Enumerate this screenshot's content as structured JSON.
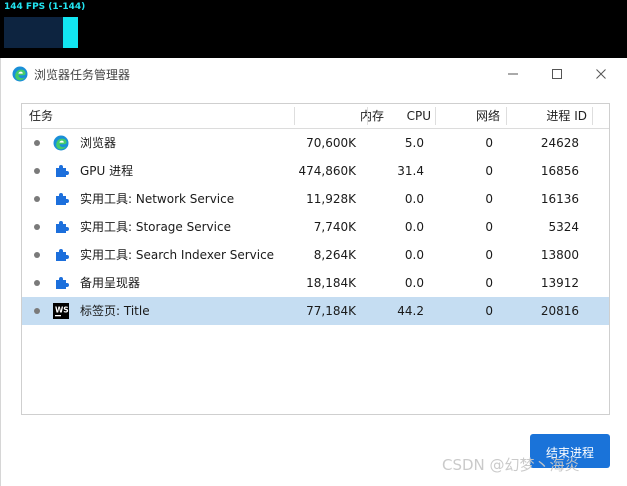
{
  "overlay": {
    "fps_text": "144 FPS (1-144)"
  },
  "window": {
    "title": "浏览器任务管理器"
  },
  "table": {
    "columns": [
      "任务",
      "内存",
      "CPU",
      "网络",
      "进程 ID"
    ],
    "rows": [
      {
        "icon": "edge-icon",
        "name": "浏览器",
        "memory": "70,600K",
        "cpu": "5.0",
        "network": "0",
        "pid": "24628"
      },
      {
        "icon": "puzzle-icon",
        "name": "GPU 进程",
        "memory": "474,860K",
        "cpu": "31.4",
        "network": "0",
        "pid": "16856"
      },
      {
        "icon": "puzzle-icon",
        "name": "实用工具: Network Service",
        "memory": "11,928K",
        "cpu": "0.0",
        "network": "0",
        "pid": "16136"
      },
      {
        "icon": "puzzle-icon",
        "name": "实用工具: Storage Service",
        "memory": "7,740K",
        "cpu": "0.0",
        "network": "0",
        "pid": "5324"
      },
      {
        "icon": "puzzle-icon",
        "name": "实用工具: Search Indexer Service",
        "memory": "8,264K",
        "cpu": "0.0",
        "network": "0",
        "pid": "13800"
      },
      {
        "icon": "puzzle-icon",
        "name": "备用呈现器",
        "memory": "18,184K",
        "cpu": "0.0",
        "network": "0",
        "pid": "13912"
      },
      {
        "icon": "webstorm-icon",
        "name": "标签页: Title",
        "memory": "77,184K",
        "cpu": "44.2",
        "network": "0",
        "pid": "20816",
        "selected": true
      }
    ]
  },
  "end_button": "结束进程",
  "watermark": "CSDN @幻梦丶海炎",
  "colors": {
    "selection": "#c5ddf2",
    "button": "#1a73d9",
    "puzzle": "#1c6fdc",
    "fps_bar": "#12e6f2"
  }
}
